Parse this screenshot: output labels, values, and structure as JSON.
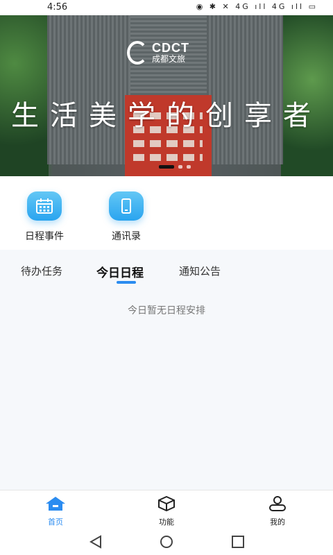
{
  "status_bar": {
    "time": "4:56",
    "icons_text": "◉ ✱ ✕ 4G ıll 4G ıll ▭"
  },
  "banner": {
    "logo_en": "CDCT",
    "logo_cn": "成都文旅",
    "slogan": "生活美学的创享者"
  },
  "shortcuts": [
    {
      "label": "日程事件",
      "icon": "calendar-icon"
    },
    {
      "label": "通讯录",
      "icon": "phone-icon"
    }
  ],
  "tabs": [
    {
      "label": "待办任务",
      "active": false
    },
    {
      "label": "今日日程",
      "active": true
    },
    {
      "label": "通知公告",
      "active": false
    }
  ],
  "empty_message": "今日暂无日程安排",
  "bottom_nav": [
    {
      "label": "首页",
      "icon": "home-icon",
      "active": true
    },
    {
      "label": "功能",
      "icon": "cube-icon",
      "active": false
    },
    {
      "label": "我的",
      "icon": "user-icon",
      "active": false
    }
  ],
  "system_nav": [
    "back-icon",
    "home-circle-icon",
    "recent-apps-icon"
  ],
  "colors": {
    "accent": "#2b8cf0",
    "icon_gradient_top": "#63c7f5",
    "icon_gradient_bottom": "#2aa4ef",
    "court": "#c0392b"
  }
}
